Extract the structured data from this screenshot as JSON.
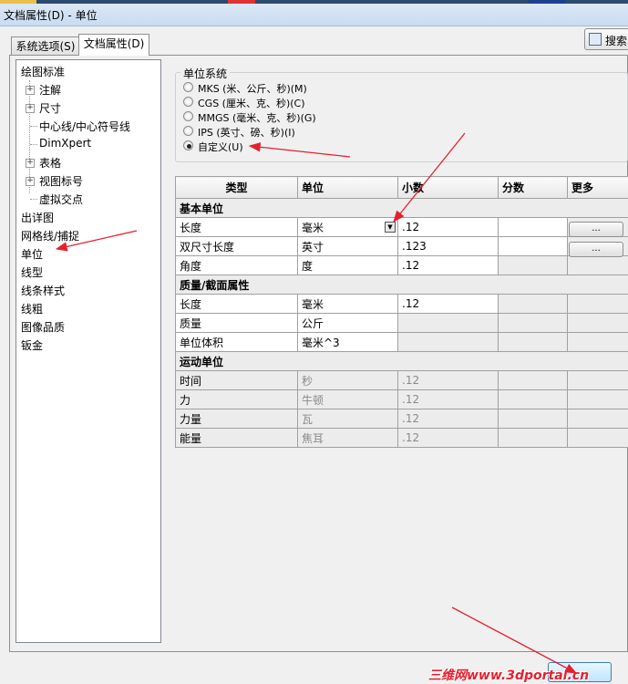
{
  "window": {
    "title": "文档属性(D) - 单位"
  },
  "tabs": [
    {
      "label": "系统选项(S)",
      "active": false
    },
    {
      "label": "文档属性(D)",
      "active": true
    }
  ],
  "toolbar": {
    "search_label": "搜索"
  },
  "tree": {
    "items": [
      {
        "label": "绘图标准",
        "level": 0
      },
      {
        "label": "注解",
        "level": 1,
        "expandable": true
      },
      {
        "label": "尺寸",
        "level": 1,
        "expandable": true
      },
      {
        "label": "中心线/中心符号线",
        "level": 2
      },
      {
        "label": "DimXpert",
        "level": 2
      },
      {
        "label": "表格",
        "level": 1,
        "expandable": true
      },
      {
        "label": "视图标号",
        "level": 1,
        "expandable": true
      },
      {
        "label": "虚拟交点",
        "level": 2
      },
      {
        "label": "出详图",
        "level": 0
      },
      {
        "label": "网格线/捕捉",
        "level": 0
      },
      {
        "label": "单位",
        "level": 0,
        "selected": true
      },
      {
        "label": "线型",
        "level": 0
      },
      {
        "label": "线条样式",
        "level": 0
      },
      {
        "label": "线粗",
        "level": 0
      },
      {
        "label": "图像品质",
        "level": 0
      },
      {
        "label": "钣金",
        "level": 0
      }
    ]
  },
  "unit_system": {
    "label": "单位系统",
    "options": [
      {
        "label": "MKS (米、公斤、秒)(M)",
        "selected": false
      },
      {
        "label": "CGS (厘米、克、秒)(C)",
        "selected": false
      },
      {
        "label": "MMGS (毫米、克、秒)(G)",
        "selected": false
      },
      {
        "label": "IPS (英寸、磅、秒)(I)",
        "selected": false
      },
      {
        "label": "自定义(U)",
        "selected": true
      }
    ]
  },
  "table": {
    "headers": [
      "类型",
      "单位",
      "小数",
      "分数",
      "更多"
    ],
    "sections": [
      {
        "title": "基本单位",
        "rows": [
          {
            "type": "长度",
            "unit": "毫米",
            "decimal": ".12",
            "fraction": "",
            "more": "...",
            "dropdown": true
          },
          {
            "type": "双尺寸长度",
            "unit": "英寸",
            "decimal": ".123",
            "fraction": "",
            "more": "..."
          },
          {
            "type": "角度",
            "unit": "度",
            "decimal": ".12",
            "fraction": "",
            "more": ""
          }
        ]
      },
      {
        "title": "质量/截面属性",
        "rows": [
          {
            "type": "长度",
            "unit": "毫米",
            "decimal": ".12",
            "fraction": "",
            "more": ""
          },
          {
            "type": "质量",
            "unit": "公斤",
            "decimal": "",
            "fraction": "",
            "more": ""
          },
          {
            "type": "单位体积",
            "unit": "毫米^3",
            "decimal": "",
            "fraction": "",
            "more": ""
          }
        ]
      },
      {
        "title": "运动单位",
        "rows": [
          {
            "type": "时间",
            "unit": "秒",
            "decimal": ".12",
            "fraction": "",
            "more": "",
            "dim": true
          },
          {
            "type": "力",
            "unit": "牛顿",
            "decimal": ".12",
            "fraction": "",
            "more": "",
            "dim": true
          },
          {
            "type": "力量",
            "unit": "瓦",
            "decimal": ".12",
            "fraction": "",
            "more": "",
            "dim": true
          },
          {
            "type": "能量",
            "unit": "焦耳",
            "decimal": ".12",
            "fraction": "",
            "more": "",
            "dim": true
          }
        ]
      }
    ]
  },
  "watermark": "三维网www.3dportal.cn",
  "colors": {
    "accent": "#e5202e",
    "title_bar": "#c9dcf0",
    "section_bg": "#ececec"
  }
}
